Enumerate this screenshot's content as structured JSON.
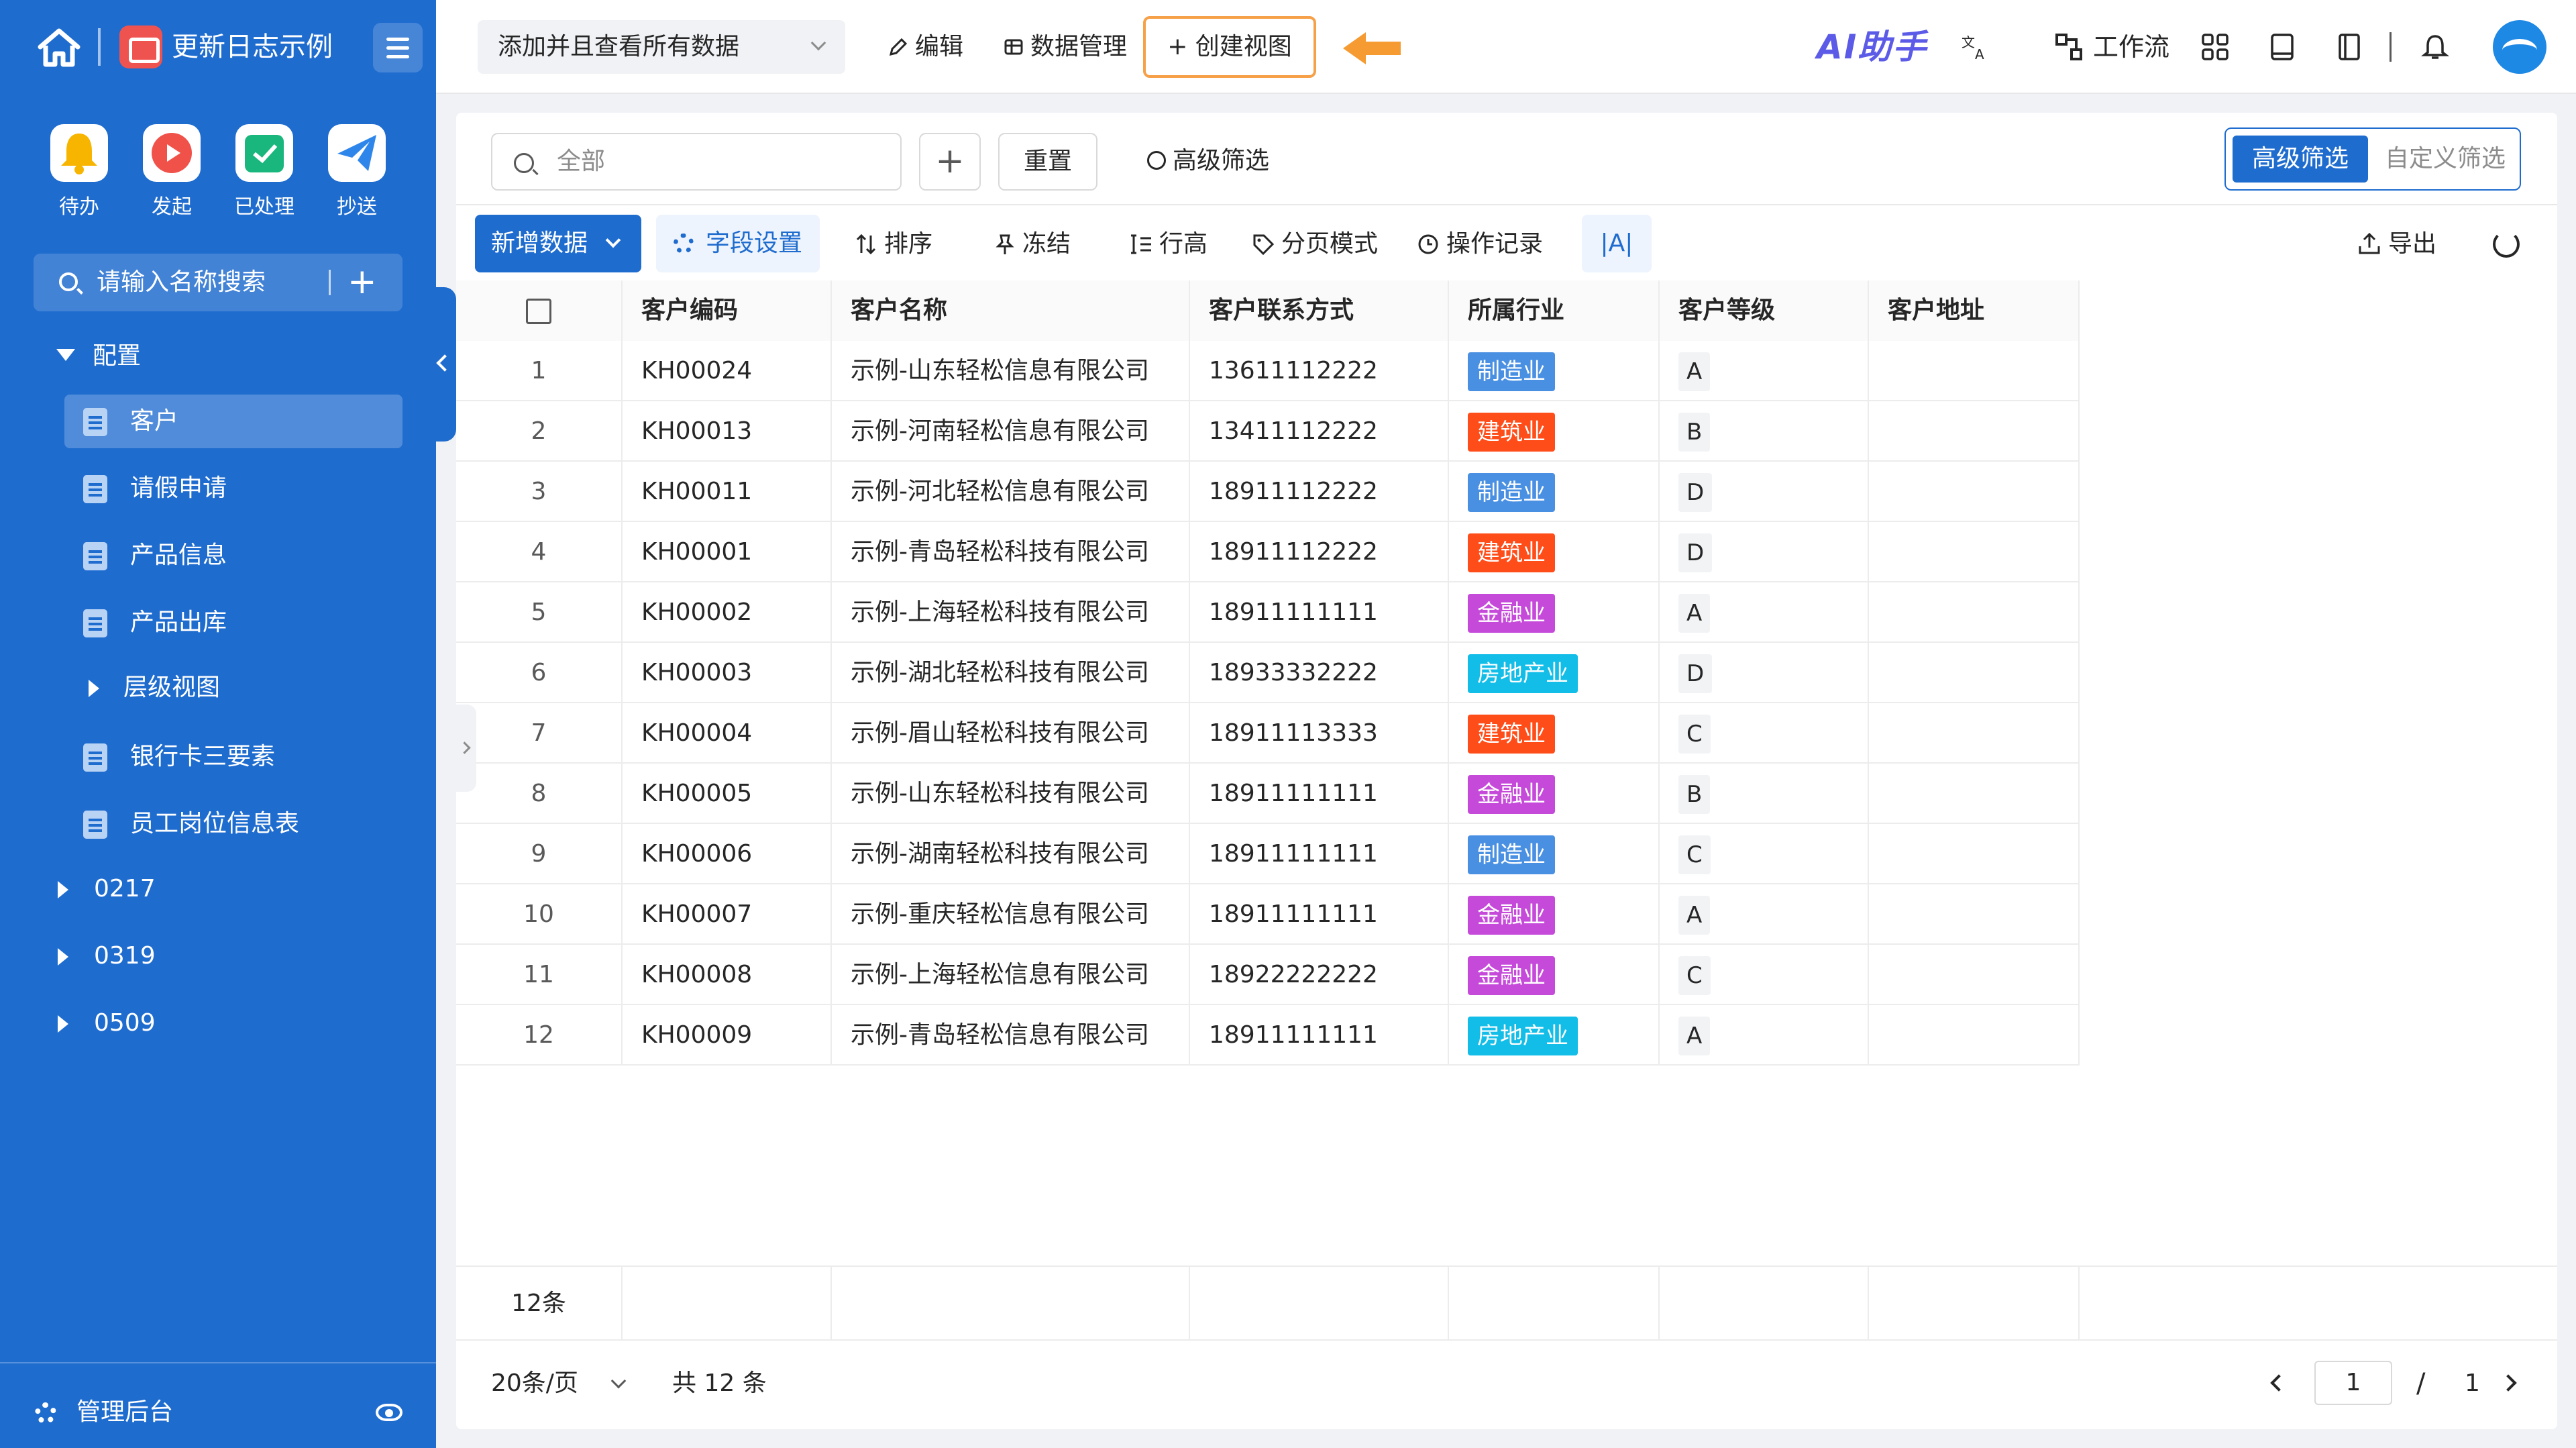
{
  "colors": {
    "sidebar": "#1f6ccf",
    "accent": "#1f6ccf",
    "highlight_border": "#f6a14a",
    "tag_manufacturing": "#4a90e2",
    "tag_construction": "#ff4d1a",
    "tag_finance": "#c54ad9",
    "tag_realestate": "#12bde8"
  },
  "sidebar": {
    "app_title": "更新日志示例",
    "quick_actions": [
      {
        "label": "待办",
        "icon": "bell-icon"
      },
      {
        "label": "发起",
        "icon": "play-icon"
      },
      {
        "label": "已处理",
        "icon": "check-box-icon"
      },
      {
        "label": "抄送",
        "icon": "paper-plane-icon"
      }
    ],
    "search_placeholder": "请输入名称搜索",
    "group_label": "配置",
    "items": [
      {
        "label": "客户",
        "active": true
      },
      {
        "label": "请假申请"
      },
      {
        "label": "产品信息"
      },
      {
        "label": "产品出库"
      },
      {
        "label": "层级视图"
      },
      {
        "label": "银行卡三要素"
      },
      {
        "label": "员工岗位信息表"
      }
    ],
    "folders": [
      "0217",
      "0319",
      "0509"
    ],
    "footer_label": "管理后台"
  },
  "topbar": {
    "view_select": "添加并且查看所有数据",
    "edit": "编辑",
    "data_manage": "数据管理",
    "create_view": "+ 创建视图",
    "ai_assistant": "AI助手",
    "workflow": "工作流"
  },
  "filter": {
    "search_placeholder": "全部",
    "add": "+",
    "reset": "重置",
    "advanced": "高级筛选",
    "seg_active": "高级筛选",
    "seg_inactive": "自定义筛选"
  },
  "toolbar": {
    "new_data": "新增数据",
    "field_settings": "字段设置",
    "sort": "排序",
    "freeze": "冻结",
    "row_height": "行高",
    "page_mode": "分页模式",
    "history": "操作记录",
    "text_a": "|A|",
    "export": "导出"
  },
  "table": {
    "columns": [
      "客户编码",
      "客户名称",
      "客户联系方式",
      "所属行业",
      "客户等级",
      "客户地址"
    ],
    "rows": [
      {
        "no": "1",
        "code": "KH00024",
        "name": "示例-山东轻松信息有限公司",
        "phone": "13611112222",
        "industry": "制造业",
        "grade": "A",
        "address": ""
      },
      {
        "no": "2",
        "code": "KH00013",
        "name": "示例-河南轻松信息有限公司",
        "phone": "13411112222",
        "industry": "建筑业",
        "grade": "B",
        "address": ""
      },
      {
        "no": "3",
        "code": "KH00011",
        "name": "示例-河北轻松信息有限公司",
        "phone": "18911112222",
        "industry": "制造业",
        "grade": "D",
        "address": ""
      },
      {
        "no": "4",
        "code": "KH00001",
        "name": "示例-青岛轻松科技有限公司",
        "phone": "18911112222",
        "industry": "建筑业",
        "grade": "D",
        "address": ""
      },
      {
        "no": "5",
        "code": "KH00002",
        "name": "示例-上海轻松科技有限公司",
        "phone": "18911111111",
        "industry": "金融业",
        "grade": "A",
        "address": ""
      },
      {
        "no": "6",
        "code": "KH00003",
        "name": "示例-湖北轻松科技有限公司",
        "phone": "18933332222",
        "industry": "房地产业",
        "grade": "D",
        "address": ""
      },
      {
        "no": "7",
        "code": "KH00004",
        "name": "示例-眉山轻松科技有限公司",
        "phone": "18911113333",
        "industry": "建筑业",
        "grade": "C",
        "address": ""
      },
      {
        "no": "8",
        "code": "KH00005",
        "name": "示例-山东轻松科技有限公司",
        "phone": "18911111111",
        "industry": "金融业",
        "grade": "B",
        "address": ""
      },
      {
        "no": "9",
        "code": "KH00006",
        "name": "示例-湖南轻松科技有限公司",
        "phone": "18911111111",
        "industry": "制造业",
        "grade": "C",
        "address": ""
      },
      {
        "no": "10",
        "code": "KH00007",
        "name": "示例-重庆轻松信息有限公司",
        "phone": "18911111111",
        "industry": "金融业",
        "grade": "A",
        "address": ""
      },
      {
        "no": "11",
        "code": "KH00008",
        "name": "示例-上海轻松信息有限公司",
        "phone": "18922222222",
        "industry": "金融业",
        "grade": "C",
        "address": ""
      },
      {
        "no": "12",
        "code": "KH00009",
        "name": "示例-青岛轻松信息有限公司",
        "phone": "18911111111",
        "industry": "房地产业",
        "grade": "A",
        "address": ""
      }
    ],
    "summary_count": "12条"
  },
  "pager": {
    "page_size": "20条/页",
    "total": "共 12 条",
    "current": "1",
    "slash": "/",
    "pages": "1"
  }
}
